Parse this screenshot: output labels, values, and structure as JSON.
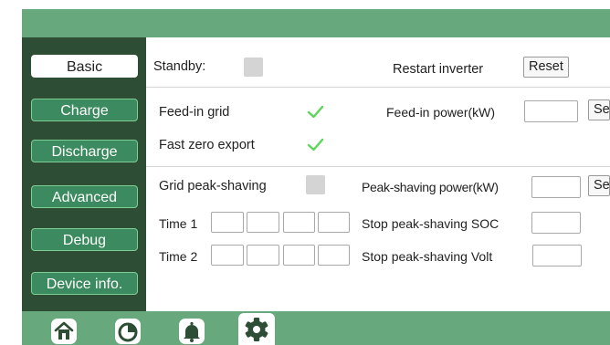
{
  "sidebar": {
    "items": [
      {
        "label": "Basic",
        "active": true
      },
      {
        "label": "Charge",
        "active": false
      },
      {
        "label": "Discharge",
        "active": false
      },
      {
        "label": "Advanced",
        "active": false
      },
      {
        "label": "Debug",
        "active": false
      },
      {
        "label": "Device info.",
        "active": false
      }
    ]
  },
  "basic": {
    "standby_label": "Standby:",
    "standby_checked": false,
    "restart_label": "Restart inverter",
    "reset_button": "Reset",
    "feed_in_grid_label": "Feed-in grid",
    "feed_in_grid_checked": true,
    "feed_in_power_label": "Feed-in power(kW)",
    "feed_in_power_value": "",
    "feed_in_set_button": "Se",
    "fast_zero_export_label": "Fast zero export",
    "fast_zero_export_checked": true,
    "grid_peak_shaving_label": "Grid peak-shaving",
    "grid_peak_shaving_checked": false,
    "peak_shaving_power_label": "Peak-shaving power(kW)",
    "peak_shaving_power_value": "",
    "peak_shaving_set_button": "Se",
    "time1_label": "Time 1",
    "time2_label": "Time 2",
    "stop_soc_label": "Stop peak-shaving SOC",
    "stop_soc_value": "",
    "stop_volt_label": "Stop peak-shaving Volt",
    "stop_volt_value": ""
  },
  "bottom_nav": [
    {
      "icon": "home-icon"
    },
    {
      "icon": "pie-chart-icon"
    },
    {
      "icon": "bell-icon"
    },
    {
      "icon": "gear-icon",
      "active": true
    }
  ],
  "colors": {
    "header_green": "#67a97c",
    "sidebar_dark": "#2d4d35",
    "nav_button": "#3c8a5f",
    "check_green": "#5dd55a"
  }
}
